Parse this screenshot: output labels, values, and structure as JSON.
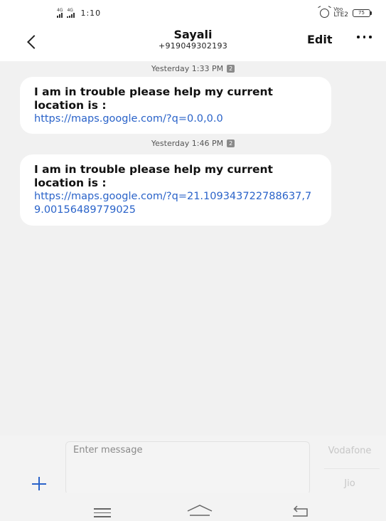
{
  "status_bar": {
    "network_1": "4G",
    "network_2": "4G",
    "time": "1:10",
    "volte_top": "Voo",
    "volte_bottom": "LTE2",
    "battery": "75",
    "battery_level_percent": 75
  },
  "header": {
    "contact_name": "Sayali",
    "contact_number": "+919049302193",
    "edit_label": "Edit",
    "back_icon": "chevron-left-icon",
    "more_icon": "more-dots-icon"
  },
  "messages": [
    {
      "timestamp": "Yesterday 1:33 PM",
      "sim": "2",
      "text": "I am in trouble please help my current location is :",
      "link": "https://maps.google.com/?q=0.0,0.0"
    },
    {
      "timestamp": "Yesterday 1:46 PM",
      "sim": "2",
      "text": "I am in trouble please help my current location is :",
      "link": "https://maps.google.com/?q=21.109343722788637,79.00156489779025"
    }
  ],
  "composer": {
    "placeholder": "Enter message",
    "sim_1_label": "Vodafone",
    "sim_2_label": "Jio"
  },
  "colors": {
    "link": "#2a63c9",
    "accent": "#2a63c9",
    "bubble": "#ffffff",
    "background": "#f1f1f1"
  }
}
